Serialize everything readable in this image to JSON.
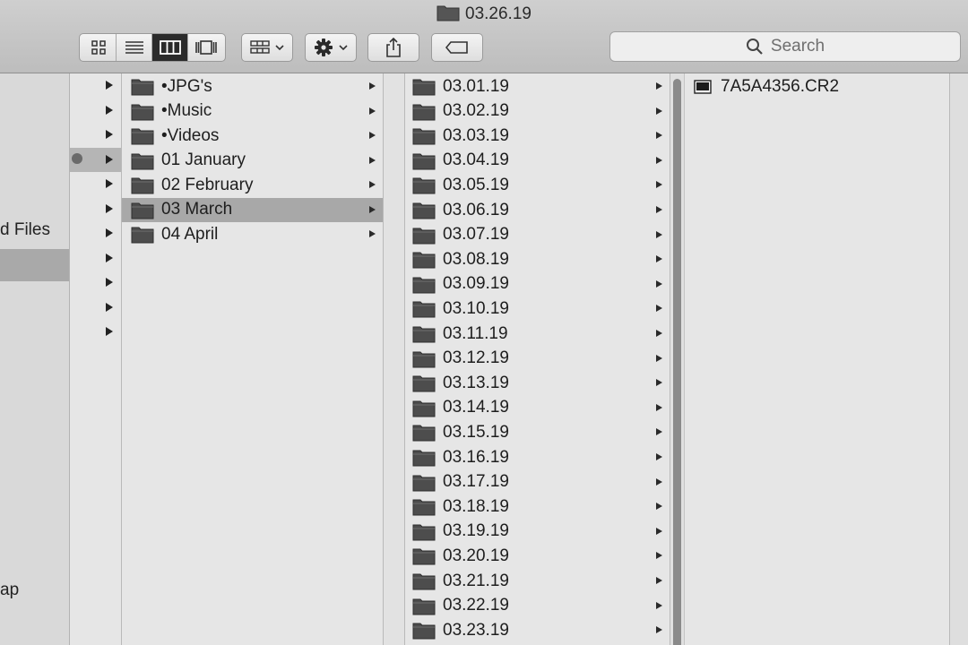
{
  "window": {
    "title": "03.26.19"
  },
  "toolbar": {
    "view_modes": [
      "icon-view",
      "list-view",
      "column-view",
      "gallery-view"
    ],
    "active_view": "column-view",
    "search": {
      "placeholder": "Search"
    }
  },
  "sidebar": {
    "items": [
      "d Files",
      "ap"
    ]
  },
  "columns": {
    "parent": [
      "•JPG's",
      "•Music",
      "•Videos",
      "01 January",
      "02 February",
      "03 March",
      "04 April"
    ],
    "parent_selected": "03 March",
    "days": [
      "03.01.19",
      "03.02.19",
      "03.03.19",
      "03.04.19",
      "03.05.19",
      "03.06.19",
      "03.07.19",
      "03.08.19",
      "03.09.19",
      "03.10.19",
      "03.11.19",
      "03.12.19",
      "03.13.19",
      "03.14.19",
      "03.15.19",
      "03.16.19",
      "03.17.19",
      "03.18.19",
      "03.19.19",
      "03.20.19",
      "03.21.19",
      "03.22.19",
      "03.23.19"
    ],
    "files": [
      "7A5A4356.CR2"
    ]
  },
  "colors": {
    "selection": "#a8a8a8",
    "active_segment": "#2b2b2b"
  }
}
